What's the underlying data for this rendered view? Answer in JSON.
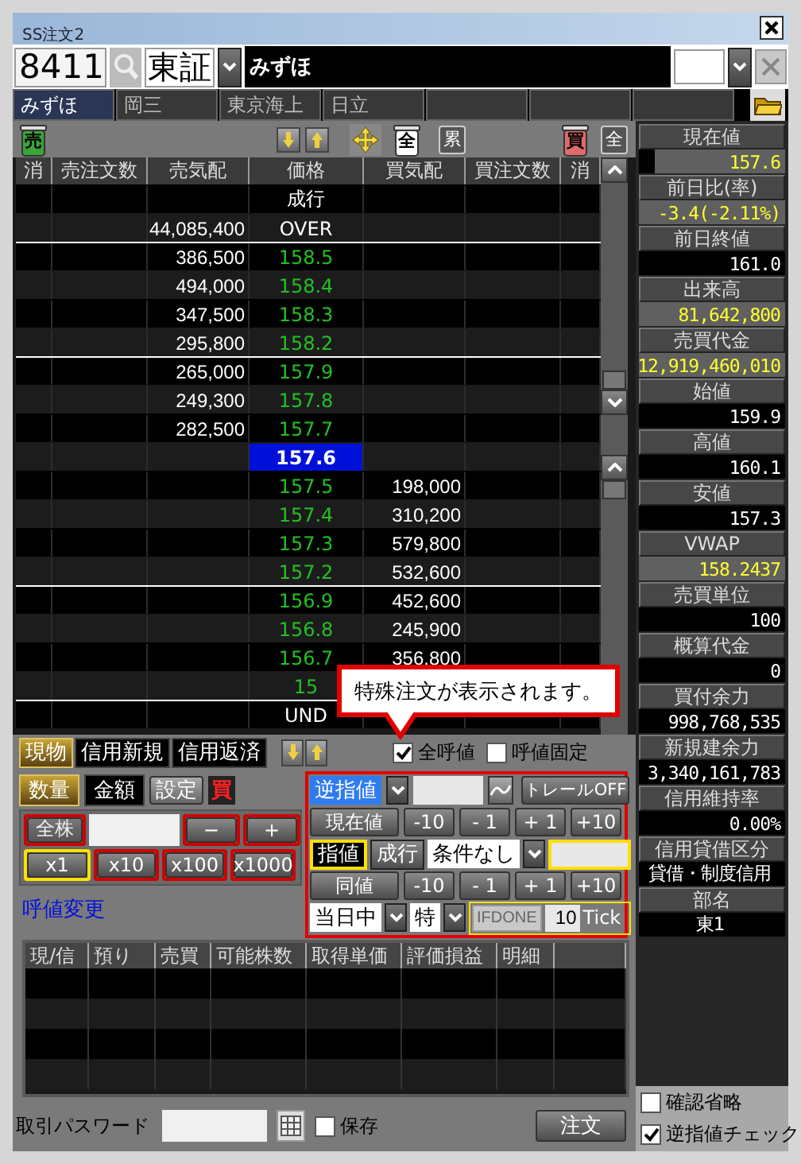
{
  "window": {
    "title": "SS注文2"
  },
  "symbol_bar": {
    "code": "8411",
    "market": "東証",
    "name": "みずほ"
  },
  "favorite_tabs": [
    {
      "label": "みずほ",
      "selected": true
    },
    {
      "label": "岡三",
      "selected": false
    },
    {
      "label": "東京海上",
      "selected": false
    },
    {
      "label": "日立",
      "selected": false
    },
    {
      "selected": false
    },
    {
      "selected": false
    },
    {
      "selected": false
    }
  ],
  "toolbar": [
    {
      "kind": "bin",
      "label": "売",
      "color": "#3aa53a"
    },
    {
      "kind": "down-arrow"
    },
    {
      "kind": "up-arrow"
    },
    {
      "kind": "move"
    },
    {
      "kind": "bin",
      "label": "全",
      "color": "#ffffff"
    },
    {
      "kind": "button",
      "label": "累"
    },
    {
      "kind": "bin",
      "label": "買",
      "color": "#e06a6a"
    },
    {
      "kind": "button",
      "label": "全"
    }
  ],
  "order_book": {
    "columns": [
      "消",
      "売注文数",
      "売気配",
      "価格",
      "買気配",
      "買注文数",
      "消"
    ],
    "rows": [
      {
        "kind": "market",
        "price": "成行",
        "group_start": false
      },
      {
        "kind": "over",
        "sell_qty": "44,085,400",
        "price": "OVER",
        "group_start": false
      },
      {
        "kind": "quote",
        "sell_qty": "386,500",
        "price": "158.5",
        "group_start": true
      },
      {
        "kind": "quote",
        "sell_qty": "494,000",
        "price": "158.4",
        "group_start": false
      },
      {
        "kind": "quote",
        "sell_qty": "347,500",
        "price": "158.3",
        "group_start": false
      },
      {
        "kind": "quote",
        "sell_qty": "295,800",
        "price": "158.2",
        "group_start": false
      },
      {
        "kind": "quote",
        "sell_qty": "265,000",
        "price": "157.9",
        "group_start": true
      },
      {
        "kind": "quote",
        "sell_qty": "249,300",
        "price": "157.8",
        "group_start": false
      },
      {
        "kind": "quote",
        "sell_qty": "282,500",
        "price": "157.7",
        "group_start": false
      },
      {
        "kind": "current",
        "price": "157.6",
        "group_start": false
      },
      {
        "kind": "quote",
        "price": "157.5",
        "buy_qty": "198,000",
        "group_start": false
      },
      {
        "kind": "quote",
        "price": "157.4",
        "buy_qty": "310,200",
        "group_start": false
      },
      {
        "kind": "quote",
        "price": "157.3",
        "buy_qty": "579,800",
        "group_start": false
      },
      {
        "kind": "quote",
        "price": "157.2",
        "buy_qty": "532,600",
        "group_start": false
      },
      {
        "kind": "quote",
        "price": "156.9",
        "buy_qty": "452,600",
        "group_start": true
      },
      {
        "kind": "quote",
        "price": "156.8",
        "buy_qty": "245,900",
        "group_start": false
      },
      {
        "kind": "quote",
        "price": "156.7",
        "buy_qty": "356,800",
        "group_start": false
      },
      {
        "kind": "quote",
        "price": "15",
        "group_start": false
      },
      {
        "kind": "under",
        "price": "UND",
        "group_start": true
      }
    ]
  },
  "quotes": [
    {
      "label": "現在値",
      "value": "157.6",
      "kind": "current"
    },
    {
      "label": "前日比(率)",
      "value": "-3.4(-2.11%)",
      "kind": "live"
    },
    {
      "label": "前日終値",
      "value": "161.0",
      "kind": "plain"
    },
    {
      "label": "出来高",
      "value": "81,642,800",
      "kind": "live"
    },
    {
      "label": "売買代金",
      "value": "12,919,460,010",
      "kind": "live"
    },
    {
      "label": "始値",
      "value": "159.9",
      "kind": "plain"
    },
    {
      "label": "高値",
      "value": "160.1",
      "kind": "plain"
    },
    {
      "label": "安値",
      "value": "157.3",
      "kind": "plain"
    },
    {
      "label": "VWAP",
      "value": "158.2437",
      "kind": "live"
    },
    {
      "label": "売買単位",
      "value": "100",
      "kind": "plain"
    },
    {
      "label": "概算代金",
      "value": "0",
      "kind": "plain"
    },
    {
      "label": "買付余力",
      "value": "998,768,535",
      "kind": "plain"
    },
    {
      "label": "新規建余力",
      "value": "3,340,161,783",
      "kind": "plain"
    },
    {
      "label": "信用維持率",
      "value": "0.00%",
      "kind": "plain"
    },
    {
      "label": "信用貸借区分",
      "value": "貸借・制度信用",
      "kind": "text"
    },
    {
      "label": "部名",
      "value": "東1",
      "kind": "text"
    }
  ],
  "side_checks": [
    {
      "label": "確認省略",
      "checked": false
    },
    {
      "label": "逆指値チェック",
      "checked": true
    }
  ],
  "trade_tabs": [
    {
      "label": "現物",
      "selected": true
    },
    {
      "label": "信用新規",
      "selected": false
    },
    {
      "label": "信用返済",
      "selected": false
    }
  ],
  "tick_options": [
    {
      "label": "全呼値",
      "checked": true
    },
    {
      "label": "呼値固定",
      "checked": false
    }
  ],
  "quantity": {
    "modes": [
      {
        "label": "数量",
        "selected": true
      },
      {
        "label": "金額",
        "selected": false
      }
    ],
    "settings_button": "設定",
    "side": "買",
    "all_shares_button": {
      "label": "全株",
      "disabled": true
    },
    "step_buttons": [
      "−",
      "+"
    ],
    "multipliers": [
      {
        "label": "x1",
        "selected": true
      },
      {
        "label": "x10",
        "selected": false
      },
      {
        "label": "x100",
        "selected": false
      },
      {
        "label": "x1000",
        "selected": false
      }
    ],
    "tick_change_link": "呼値変更"
  },
  "special_order": {
    "order_type": "逆指値",
    "trail_button": "トレールOFF",
    "trigger_buttons": [
      "現在値",
      "-10",
      "- 1",
      "+ 1",
      "+10"
    ],
    "price_types": [
      {
        "label": "指値",
        "selected": true
      },
      {
        "label": "成行",
        "selected": false
      }
    ],
    "condition": "条件なし",
    "price_buttons": [
      "同値",
      "-10",
      "- 1",
      "+ 1",
      "+10"
    ],
    "term": "当日中",
    "special": "特",
    "ifdone_button": "IFDONE",
    "tick_value": "10",
    "tick_unit": "Tick"
  },
  "callout": "特殊注文が表示されます。",
  "positions": {
    "columns": [
      "現/信",
      "預り",
      "売買",
      "可能株数",
      "取得単価",
      "評価損益",
      "明細"
    ]
  },
  "footer": {
    "password_label": "取引パスワード",
    "save": {
      "label": "保存",
      "checked": false
    },
    "order_button": "注文"
  }
}
